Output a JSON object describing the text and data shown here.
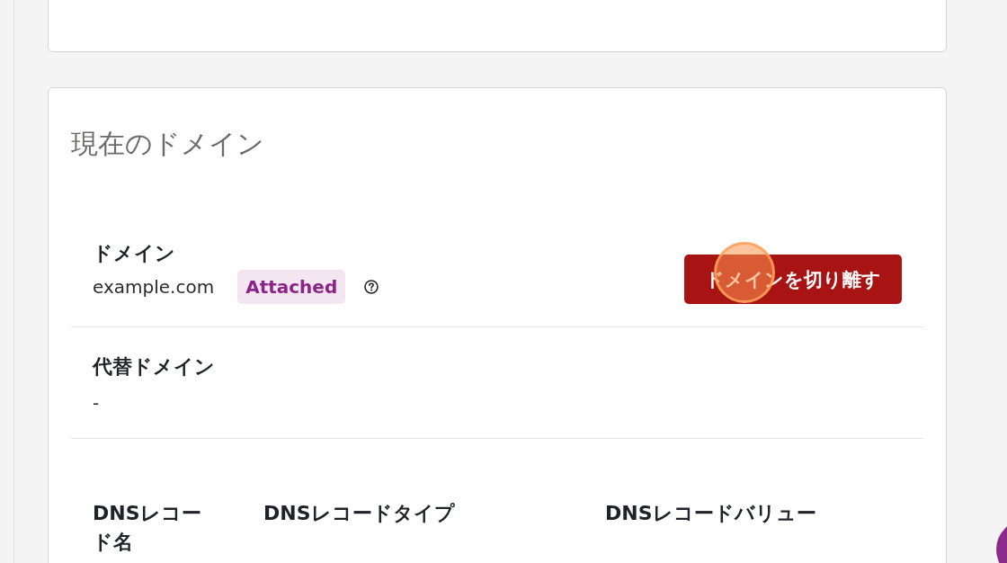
{
  "current_domain": {
    "title": "現在のドメイン",
    "domain": {
      "label": "ドメイン",
      "value": "example.com",
      "status_badge": "Attached",
      "detach_button": "ドメインを切り離す"
    },
    "alternate_domain": {
      "label": "代替ドメイン",
      "value": "-"
    },
    "dns_table": {
      "columns": [
        "DNSレコード名",
        "DNSレコードタイプ",
        "DNSレコードバリュー"
      ]
    }
  }
}
